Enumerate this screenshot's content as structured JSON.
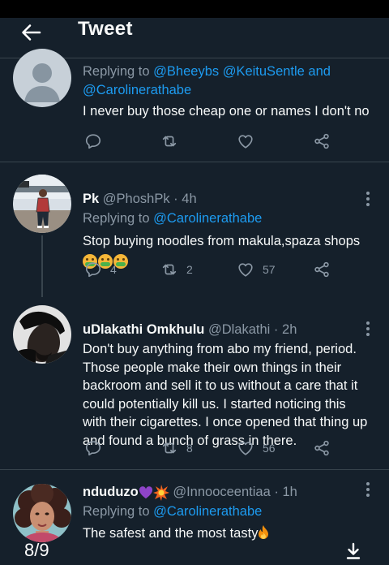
{
  "header": {
    "title": "Tweet",
    "back_icon": "arrow-left-icon"
  },
  "colors": {
    "background": "#15202b",
    "accent": "#1d9bf0",
    "secondary_text": "#8b98a5",
    "divider": "#38444d"
  },
  "tweets": [
    {
      "reply_prefix": "Replying to",
      "mentions_line1": "@Bheeybs @KeituSentle and",
      "mentions_line2": "@Carolinerathabe",
      "text": "I never buy those cheap one or names I don't no",
      "actions": {
        "reply": "",
        "retweet": "",
        "like": ""
      }
    },
    {
      "name": "Pk",
      "handle": "@PhoshPk",
      "separator": "·",
      "time": "4h",
      "reply_prefix": "Replying to",
      "mention": "@Carolinerathabe",
      "text": "Stop buying noodles from makula,spaza shops",
      "emojis": [
        "nauseated-face-emoji",
        "nauseated-face-emoji",
        "nauseated-face-emoji"
      ],
      "actions": {
        "reply": "4",
        "retweet": "2",
        "like": "57"
      }
    },
    {
      "name": "uDlakathi Omkhulu",
      "handle": "@Dlakathi",
      "separator": "·",
      "time": "2h",
      "text_lines": [
        "Don't buy anything from abo my friend, period.",
        "Those people make their own things in their",
        "backroom and sell it to us without a care that it",
        "could potentially kill us. I started noticing this",
        "with their cigarettes. I once opened that thing up",
        "and found a bunch of grass in there."
      ],
      "actions": {
        "reply": "",
        "retweet": "8",
        "like": "56"
      }
    },
    {
      "name": "nduduzo",
      "name_emojis": [
        "purple-heart-emoji",
        "collision-emoji"
      ],
      "handle": "@Innooceentiaa",
      "separator": "·",
      "time": "1h",
      "reply_prefix": "Replying to",
      "mention": "@Carolinerathabe",
      "text": "The safest and the most tasty",
      "text_emoji": "fire-emoji"
    }
  ],
  "footer": {
    "page_indicator": "8/9",
    "download_icon": "download-icon"
  }
}
